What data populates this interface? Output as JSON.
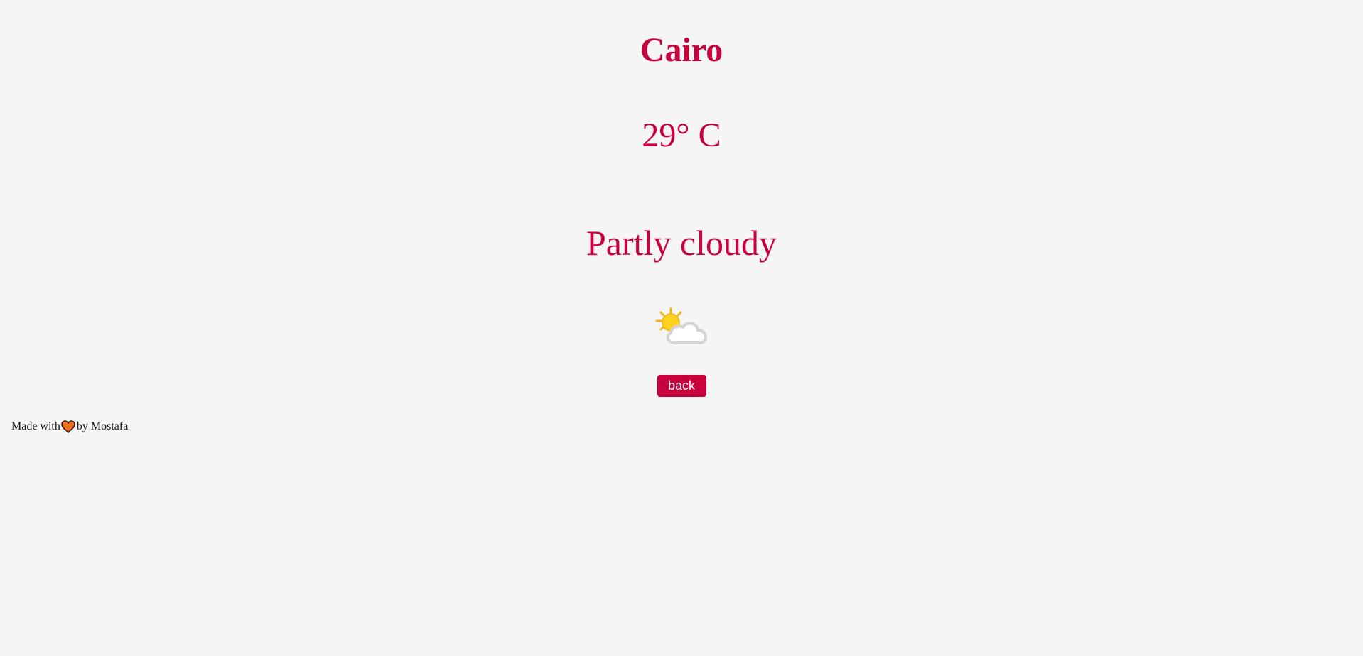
{
  "weather": {
    "city": "Cairo",
    "temperature": "29° C",
    "condition": "Partly cloudy",
    "icon": "partly-cloudy-icon"
  },
  "actions": {
    "back_label": "back"
  },
  "footer": {
    "prefix": "Made with",
    "icon": "heart-icon",
    "suffix": "by Mostafa"
  },
  "colors": {
    "background": "#f5f5f5",
    "accent": "#c8003c",
    "button_text": "#ffffff",
    "heart": "#f26a1b"
  }
}
